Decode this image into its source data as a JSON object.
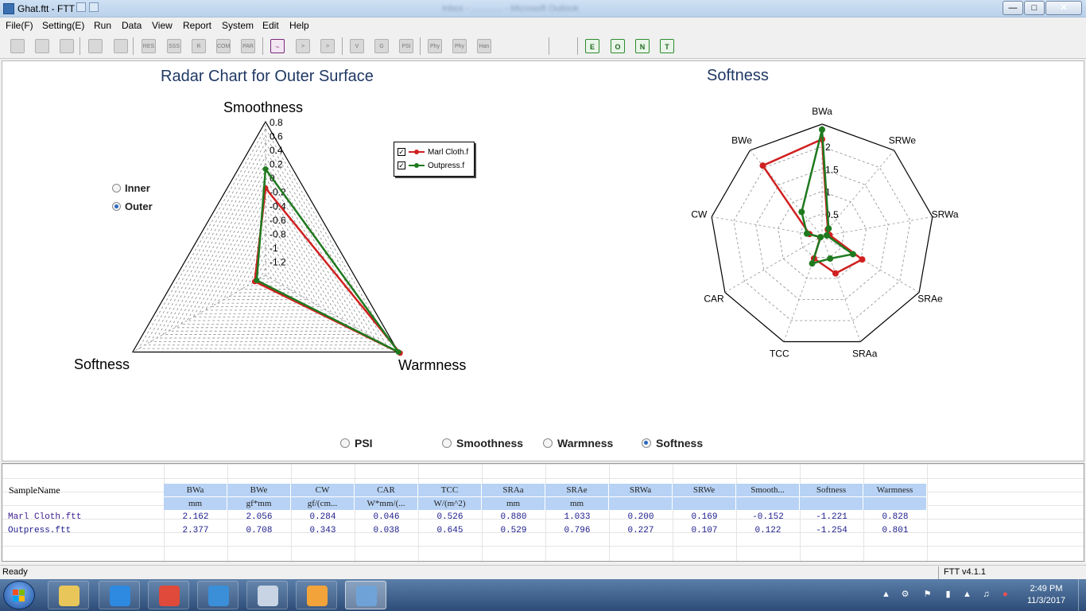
{
  "window": {
    "title": "Ghat.ftt - FTT",
    "blurred_title": "Inbox - ............. - Microsoft Outlook"
  },
  "menu": [
    "File(F)",
    "Setting(E)",
    "Run",
    "Data",
    "View",
    "Report",
    "System",
    "Edit",
    "Help"
  ],
  "toolbar": {
    "icons": [
      {
        "name": "new-file-icon",
        "label": ""
      },
      {
        "name": "open-folder-icon",
        "label": ""
      },
      {
        "name": "save-icon",
        "label": ""
      },
      {
        "name": "arrow-right-icon",
        "label": ""
      },
      {
        "name": "record-icon",
        "label": ""
      },
      {
        "name": "res-icon",
        "label": "RES"
      },
      {
        "name": "waves-icon",
        "label": "SSS"
      },
      {
        "name": "refresh-icon",
        "label": "R"
      },
      {
        "name": "com-icon",
        "label": "COM"
      },
      {
        "name": "par-icon",
        "label": "PAR"
      },
      {
        "name": "chart-icon",
        "label": "~"
      },
      {
        "name": "export-icon",
        "label": ">"
      },
      {
        "name": "import-icon",
        "label": ">"
      },
      {
        "name": "v-icon",
        "label": "V"
      },
      {
        "name": "g-icon",
        "label": "G"
      },
      {
        "name": "psi-icon",
        "label": "PSI"
      },
      {
        "name": "phy1-icon",
        "label": "Phy"
      },
      {
        "name": "phy2-icon",
        "label": "Phy"
      },
      {
        "name": "han-icon",
        "label": "Han"
      },
      {
        "name": "export-green-icon",
        "label": "E"
      },
      {
        "name": "open-green-icon",
        "label": "O"
      },
      {
        "name": "new-green-icon",
        "label": "N"
      },
      {
        "name": "table-green-icon",
        "label": "T"
      }
    ]
  },
  "left_chart": {
    "title": "Radar Chart for Outer Surface",
    "view_options": [
      {
        "label": "Inner",
        "selected": false
      },
      {
        "label": "Outer",
        "selected": true
      }
    ],
    "legend": [
      {
        "label": "Marl Cloth.f",
        "checked": true,
        "color": "#d02020"
      },
      {
        "label": "Outpress.f",
        "checked": true,
        "color": "#1f7a1f"
      }
    ]
  },
  "right_chart": {
    "title": "Softness"
  },
  "chart_data": [
    {
      "type": "radar",
      "title": "Radar Chart for Outer Surface",
      "axes": [
        "Smoothness",
        "Warmness",
        "Softness"
      ],
      "tick_labels": [
        "0.8",
        "0.6",
        "0.4",
        "0.2",
        "0",
        "-0.2",
        "-0.4",
        "-0.6",
        "-0.8",
        "-1",
        "-1.2"
      ],
      "range": [
        -1.4,
        0.8
      ],
      "series": [
        {
          "name": "Marl Cloth.f",
          "color": "#d02020",
          "values": [
            -0.152,
            0.828,
            -1.221
          ]
        },
        {
          "name": "Outpress.f",
          "color": "#1f7a1f",
          "values": [
            0.122,
            0.801,
            -1.254
          ]
        }
      ]
    },
    {
      "type": "radar",
      "title": "Softness",
      "axes": [
        "BWa",
        "SRWe",
        "SRWa",
        "SRAe",
        "SRAa",
        "TCC",
        "CAR",
        "CW",
        "BWe"
      ],
      "tick_labels": [
        "2",
        "1.5",
        "1",
        "0.5"
      ],
      "range": [
        0,
        2.5
      ],
      "series": [
        {
          "name": "Marl Cloth.ftt",
          "color": "#d02020",
          "values": [
            2.162,
            0.2,
            0.169,
            1.033,
            0.88,
            0.526,
            0.046,
            0.284,
            2.056
          ]
        },
        {
          "name": "Outpress.ftt",
          "color": "#1f7a1f",
          "values": [
            2.377,
            0.227,
            0.107,
            0.796,
            0.529,
            0.645,
            0.038,
            0.343,
            0.708
          ]
        }
      ]
    }
  ],
  "bottom_options": [
    {
      "label": "PSI",
      "selected": false
    },
    {
      "label": "Smoothness",
      "selected": false
    },
    {
      "label": "Warmness",
      "selected": false
    },
    {
      "label": "Softness",
      "selected": true
    }
  ],
  "table": {
    "name_header": "SampleName",
    "columns": [
      {
        "name": "BWa",
        "unit": "mm"
      },
      {
        "name": "BWe",
        "unit": "gf*mm"
      },
      {
        "name": "CW",
        "unit": "gf/(cm..."
      },
      {
        "name": "CAR",
        "unit": "W*mm/(..."
      },
      {
        "name": "TCC",
        "unit": "W/(m^2)"
      },
      {
        "name": "SRAa",
        "unit": "mm"
      },
      {
        "name": "SRAe",
        "unit": "mm"
      },
      {
        "name": "SRWa",
        "unit": ""
      },
      {
        "name": "SRWe",
        "unit": ""
      },
      {
        "name": "Smooth...",
        "unit": ""
      },
      {
        "name": "Softness",
        "unit": ""
      },
      {
        "name": "Warmness",
        "unit": ""
      }
    ],
    "rows": [
      {
        "name": "Marl Cloth.ftt",
        "values": [
          "2.162",
          "2.056",
          "0.284",
          "0.046",
          "0.526",
          "0.880",
          "1.033",
          "0.200",
          "0.169",
          "-0.152",
          "-1.221",
          "0.828"
        ]
      },
      {
        "name": "Outpress.ftt",
        "values": [
          "2.377",
          "0.708",
          "0.343",
          "0.038",
          "0.645",
          "0.529",
          "0.796",
          "0.227",
          "0.107",
          "0.122",
          "-1.254",
          "0.801"
        ]
      }
    ]
  },
  "status": {
    "left": "Ready",
    "version": "FTT v4.1.1"
  },
  "taskbar": {
    "apps": [
      {
        "name": "explorer-icon",
        "color": "#e8c65a",
        "active": false
      },
      {
        "name": "ie-icon",
        "color": "#2d8ae0",
        "active": false
      },
      {
        "name": "chrome-icon",
        "color": "#e04a3a",
        "active": false
      },
      {
        "name": "app-k-icon",
        "color": "#3a8fd8",
        "active": false
      },
      {
        "name": "calculator-icon",
        "color": "#c8d4e4",
        "active": false
      },
      {
        "name": "outlook-icon",
        "color": "#f2a33a",
        "active": false
      },
      {
        "name": "ftt-icon",
        "color": "#6fa3d8",
        "active": true
      }
    ],
    "time": "2:49 PM",
    "date": "11/3/2017"
  }
}
